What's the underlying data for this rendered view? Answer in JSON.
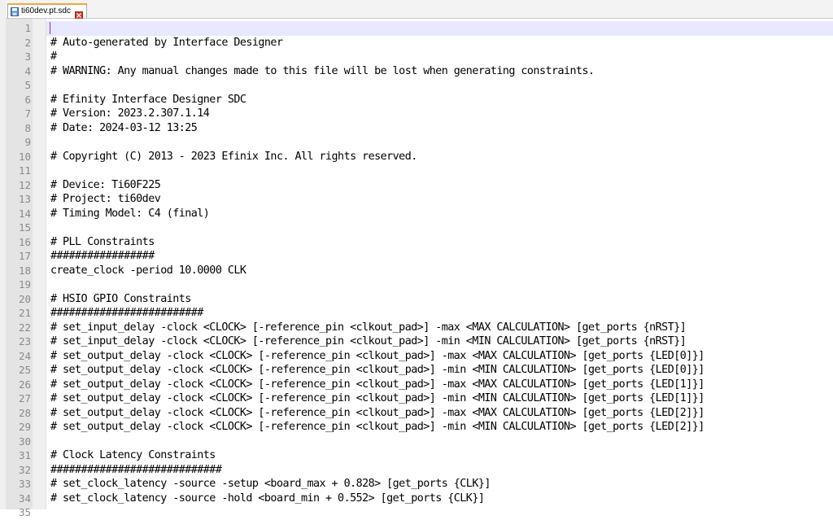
{
  "tab": {
    "title": "ti60dev.pt.sdc",
    "file_icon": "save-file-icon",
    "close_icon": "close-icon",
    "accent_color": "#f4a540",
    "close_color": "#d9362b"
  },
  "editor": {
    "current_line_color": "#e8e8ff",
    "caret_color": "#8a2be2",
    "lines": [
      "",
      "# Auto-generated by Interface Designer",
      "#",
      "# WARNING: Any manual changes made to this file will be lost when generating constraints.",
      "",
      "# Efinity Interface Designer SDC",
      "# Version: 2023.2.307.1.14",
      "# Date: 2024-03-12 13:25",
      "",
      "# Copyright (C) 2013 - 2023 Efinix Inc. All rights reserved.",
      "",
      "# Device: Ti60F225",
      "# Project: ti60dev",
      "# Timing Model: C4 (final)",
      "",
      "# PLL Constraints",
      "#################",
      "create_clock -period 10.0000 CLK",
      "",
      "# HSIO GPIO Constraints",
      "#########################",
      "# set_input_delay -clock <CLOCK> [-reference_pin <clkout_pad>] -max <MAX CALCULATION> [get_ports {nRST}]",
      "# set_input_delay -clock <CLOCK> [-reference_pin <clkout_pad>] -min <MIN CALCULATION> [get_ports {nRST}]",
      "# set_output_delay -clock <CLOCK> [-reference_pin <clkout_pad>] -max <MAX CALCULATION> [get_ports {LED[0]}]",
      "# set_output_delay -clock <CLOCK> [-reference_pin <clkout_pad>] -min <MIN CALCULATION> [get_ports {LED[0]}]",
      "# set_output_delay -clock <CLOCK> [-reference_pin <clkout_pad>] -max <MAX CALCULATION> [get_ports {LED[1]}]",
      "# set_output_delay -clock <CLOCK> [-reference_pin <clkout_pad>] -min <MIN CALCULATION> [get_ports {LED[1]}]",
      "# set_output_delay -clock <CLOCK> [-reference_pin <clkout_pad>] -max <MAX CALCULATION> [get_ports {LED[2]}]",
      "# set_output_delay -clock <CLOCK> [-reference_pin <clkout_pad>] -min <MIN CALCULATION> [get_ports {LED[2]}]",
      "",
      "# Clock Latency Constraints",
      "############################",
      "# set_clock_latency -source -setup <board_max + 0.828> [get_ports {CLK}]",
      "# set_clock_latency -source -hold <board_min + 0.552> [get_ports {CLK}]",
      ""
    ],
    "line_numbers": [
      "1",
      "2",
      "3",
      "4",
      "5",
      "6",
      "7",
      "8",
      "9",
      "10",
      "11",
      "12",
      "13",
      "14",
      "15",
      "16",
      "17",
      "18",
      "19",
      "20",
      "21",
      "22",
      "23",
      "24",
      "25",
      "26",
      "27",
      "28",
      "29",
      "30",
      "31",
      "32",
      "33",
      "34",
      "35"
    ]
  }
}
